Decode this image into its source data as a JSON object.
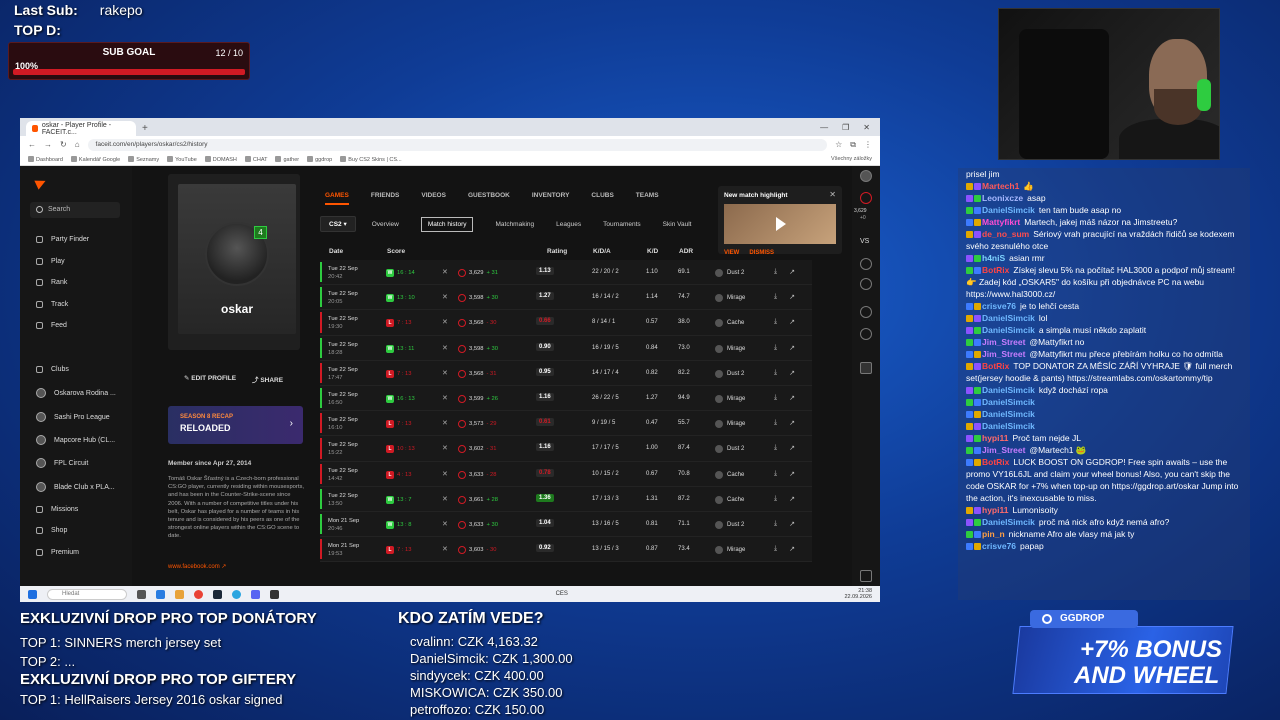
{
  "overlay": {
    "last_sub_label": "Last Sub:",
    "last_sub_value": "rakepo",
    "top_d_label": "TOP D:",
    "sub_goal_title": "SUB GOAL",
    "sub_goal_count": "12 / 10",
    "sub_goal_percent": "100%",
    "sub_goal_progress": 1.0
  },
  "browser": {
    "tab_title": "oskar - Player Profile - FACEIT.c...",
    "url": "faceit.com/en/players/oskar/cs2/history",
    "bookmarks": [
      "Dashboard",
      "Kalendář Google",
      "Seznamy",
      "YouTube",
      "DOMASH",
      "CHAT",
      "gather",
      "ggdrop",
      "Buy CS2 Skins | CS..."
    ],
    "bookmarks_right": "Všechny záložky"
  },
  "sidebar": {
    "search_placeholder": "Search",
    "items": [
      {
        "label": "Party Finder",
        "icon": "users-icon"
      },
      {
        "label": "Play",
        "icon": "play-icon"
      },
      {
        "label": "Rank",
        "icon": "trophy-icon"
      },
      {
        "label": "Track",
        "icon": "target-icon"
      },
      {
        "label": "Feed",
        "icon": "feed-icon"
      },
      {
        "label": "Clubs",
        "icon": "clubs-icon"
      },
      {
        "label": "Oskarova Rodina ...",
        "icon": "club-avatar-icon"
      },
      {
        "label": "Sashi Pro League",
        "icon": "club-avatar-icon"
      },
      {
        "label": "Mapcore Hub (CL...",
        "icon": "club-avatar-icon"
      },
      {
        "label": "FPL Circuit",
        "icon": "club-avatar-icon"
      },
      {
        "label": "Blade Club x PLA...",
        "icon": "club-avatar-icon"
      },
      {
        "label": "Missions",
        "icon": "missions-icon"
      },
      {
        "label": "Shop",
        "icon": "shop-icon"
      },
      {
        "label": "Premium",
        "icon": "premium-icon"
      }
    ]
  },
  "profile": {
    "name": "oskar",
    "level": "4",
    "edit_label": "EDIT PROFILE",
    "share_label": "SHARE",
    "recap_kicker": "SEASON 8 RECAP",
    "recap_title": "RELOADED",
    "member_since": "Member since Apr 27, 2014",
    "bio": "Tomáš Oskar Šťastný is a Czech-born professional CS:GO player, currently residing within mousesports, and has been in the Counter-Strike-scene since 2006. With a number of competitive titles under his belt, Oskar has played for a number of teams in his tenure and is considered by his peers as one of the strongest online players within the CS:GO scene to date.",
    "link": "www.facebook.com"
  },
  "topnav": [
    "GAMES",
    "FRIENDS",
    "VIDEOS",
    "GUESTBOOK",
    "INVENTORY",
    "CLUBS",
    "TEAMS"
  ],
  "subnav": {
    "game": "CS2",
    "items": [
      "Overview",
      "Match history",
      "Matchmaking",
      "Leagues",
      "Tournaments",
      "Skin Vault"
    ],
    "selected": "Match history"
  },
  "table": {
    "headers": {
      "date": "Date",
      "score": "Score",
      "rating": "Rating",
      "kda": "K/D/A",
      "kd": "K/D",
      "adr": "ADR",
      "map": "Map"
    },
    "rows": [
      {
        "day": "Tue 22 Sep",
        "time": "20:42",
        "win": true,
        "score": "16 : 14",
        "elo": "3,629",
        "delta": "+ 31",
        "rating": "1.13",
        "kda": "22 / 20 / 2",
        "kd": "1.10",
        "adr": "69.1",
        "map": "Dust 2"
      },
      {
        "day": "Tue 22 Sep",
        "time": "20:05",
        "win": true,
        "score": "13 : 10",
        "elo": "3,598",
        "delta": "+ 30",
        "rating": "1.27",
        "kda": "16 / 14 / 2",
        "kd": "1.14",
        "adr": "74.7",
        "map": "Mirage"
      },
      {
        "day": "Tue 22 Sep",
        "time": "19:30",
        "win": false,
        "score": "7 : 13",
        "elo": "3,568",
        "delta": "- 30",
        "rating": "0.66",
        "kda": "8 / 14 / 1",
        "kd": "0.57",
        "adr": "38.0",
        "map": "Cache"
      },
      {
        "day": "Tue 22 Sep",
        "time": "18:28",
        "win": true,
        "score": "13 : 11",
        "elo": "3,598",
        "delta": "+ 30",
        "rating": "0.90",
        "kda": "16 / 19 / 5",
        "kd": "0.84",
        "adr": "73.0",
        "map": "Mirage"
      },
      {
        "day": "Tue 22 Sep",
        "time": "17:47",
        "win": false,
        "score": "7 : 13",
        "elo": "3,568",
        "delta": "- 31",
        "rating": "0.95",
        "kda": "14 / 17 / 4",
        "kd": "0.82",
        "adr": "82.2",
        "map": "Dust 2"
      },
      {
        "day": "Tue 22 Sep",
        "time": "16:50",
        "win": true,
        "score": "16 : 13",
        "elo": "3,599",
        "delta": "+ 26",
        "rating": "1.16",
        "kda": "26 / 22 / 5",
        "kd": "1.27",
        "adr": "94.9",
        "map": "Mirage"
      },
      {
        "day": "Tue 22 Sep",
        "time": "16:10",
        "win": false,
        "score": "7 : 13",
        "elo": "3,573",
        "delta": "- 29",
        "rating": "0.61",
        "kda": "9 / 19 / 5",
        "kd": "0.47",
        "adr": "55.7",
        "map": "Mirage"
      },
      {
        "day": "Tue 22 Sep",
        "time": "15:22",
        "win": false,
        "score": "10 : 13",
        "elo": "3,602",
        "delta": "- 31",
        "rating": "1.16",
        "kda": "17 / 17 / 5",
        "kd": "1.00",
        "adr": "87.4",
        "map": "Dust 2"
      },
      {
        "day": "Tue 22 Sep",
        "time": "14:42",
        "win": false,
        "score": "4 : 13",
        "elo": "3,633",
        "delta": "- 28",
        "rating": "0.78",
        "kda": "10 / 15 / 2",
        "kd": "0.67",
        "adr": "70.8",
        "map": "Cache"
      },
      {
        "day": "Tue 22 Sep",
        "time": "13:50",
        "win": true,
        "score": "13 : 7",
        "elo": "3,661",
        "delta": "+ 28",
        "rating": "1.36",
        "kda": "17 / 13 / 3",
        "kd": "1.31",
        "adr": "87.2",
        "map": "Cache"
      },
      {
        "day": "Mon 21 Sep",
        "time": "20:46",
        "win": true,
        "score": "13 : 8",
        "elo": "3,633",
        "delta": "+ 30",
        "rating": "1.04",
        "kda": "13 / 16 / 5",
        "kd": "0.81",
        "adr": "71.1",
        "map": "Dust 2"
      },
      {
        "day": "Mon 21 Sep",
        "time": "19:53",
        "win": false,
        "score": "7 : 13",
        "elo": "3,603",
        "delta": "- 30",
        "rating": "0.92",
        "kda": "13 / 15 / 3",
        "kd": "0.87",
        "adr": "73.4",
        "map": "Mirage"
      }
    ]
  },
  "highlight": {
    "title": "New match highlight",
    "view": "VIEW",
    "dismiss": "DISMISS"
  },
  "rightrail": {
    "elo": "3,629",
    "elo_sub": "+0"
  },
  "taskbar": {
    "search": "Hledat",
    "time": "21:38",
    "date": "22.09.2026",
    "lang": "CES"
  },
  "chat": [
    {
      "user": "",
      "text": "prisel jim",
      "color": "#ffffff"
    },
    {
      "user": "Martech1",
      "text": "👍",
      "color": "#ff5a5a"
    },
    {
      "user": "Leonixcze",
      "text": "asap",
      "color": "#a7b8ff"
    },
    {
      "user": "DanielSimcik",
      "text": "ten tam bude asap no",
      "color": "#6fb8ff"
    },
    {
      "user": "Mattyfikrt",
      "text": "Martech, jakej máš názor na Jimstreetu?",
      "color": "#ff4dd2"
    },
    {
      "user": "de_no_sum",
      "text": "Sériový vrah pracující na vraždách řidičů se kodexem svého zesnulého otce",
      "color": "#ff4d4d"
    },
    {
      "user": "h4niS",
      "text": "asian rmr",
      "color": "#7fd4ff"
    },
    {
      "user": "BotRix",
      "text": "Získej slevu 5% na počítač HAL3000 a podpoř můj stream! 👉 Zadej kód „OSKAR5\" do košíku při objednávce PC na webu https://www.hal3000.cz/",
      "color": "#ff4444"
    },
    {
      "user": "crisve76",
      "text": "je to lehčí cesta",
      "color": "#6fb8ff"
    },
    {
      "user": "DanielSimcik",
      "text": "lol",
      "color": "#6fb8ff"
    },
    {
      "user": "DanielSimcik",
      "text": "a simpla musí někdo zaplatit",
      "color": "#6fb8ff"
    },
    {
      "user": "Jim_Street",
      "text": "@Mattyfikrt no",
      "color": "#c77dff"
    },
    {
      "user": "Jim_Street",
      "text": "@Mattyfikrt mu přece přebírám holku co ho odmítla",
      "color": "#c77dff"
    },
    {
      "user": "BotRix",
      "text": "TOP DONATOR ZA MĚSÍC ZÁŘÍ VYHRAJE 🛡 full merch set(jersey hoodie & pants) https://streamlabs.com/oskartommy/tip",
      "color": "#ff4444"
    },
    {
      "user": "DanielSimcik",
      "text": "když dochází ropa",
      "color": "#6fb8ff"
    },
    {
      "user": "DanielSimcik",
      "text": "",
      "color": "#6fb8ff"
    },
    {
      "user": "DanielSimcik",
      "text": "",
      "color": "#6fb8ff"
    },
    {
      "user": "DanielSimcik",
      "text": "",
      "color": "#6fb8ff"
    },
    {
      "user": "hypi11",
      "text": "Proč tam nejde JL",
      "color": "#ff6b6b"
    },
    {
      "user": "Jim_Street",
      "text": "@Martech1 🐸",
      "color": "#c77dff"
    },
    {
      "user": "BotRix",
      "text": "LUCK BOOST ON GGDROP! Free spin awaits – use the promo VY16L6JL and claim your wheel bonus! Also, you can't skip the code OSKAR for +7% when top-up on https://ggdrop.art/oskar Jump into the action, it's inexcusable to miss.",
      "color": "#ff4444"
    },
    {
      "user": "hypi11",
      "text": "Lumonisoity",
      "color": "#ff6b6b"
    },
    {
      "user": "DanielSimcik",
      "text": "proč má nick afro když nemá afro?",
      "color": "#6fb8ff"
    },
    {
      "user": "pin_n",
      "text": "nickname Afro ale vlasy má jak ty",
      "color": "#ff9f43"
    },
    {
      "user": "crisve76",
      "text": "papap",
      "color": "#6fb8ff"
    }
  ],
  "bottom": {
    "donor_title": "EXKLUZIVNÍ DROP PRO TOP DONÁTORY",
    "donor_top1": "TOP 1: SINNERS merch jersey set",
    "donor_top2": "TOP 2:  ...",
    "gifter_title": "EXKLUZIVNÍ DROP PRO TOP GIFTERY",
    "gifter_top1": "TOP 1: HellRaisers Jersey 2016 oskar signed",
    "leader_title": "KDO ZATÍM VEDE?",
    "leaders": [
      "cvalinn: CZK 4,163.32",
      "DanielSimcik: CZK 1,300.00",
      "sindyycek: CZK 400.00",
      "MISKOWICA: CZK 350.00",
      "petroffozo: CZK 150.00"
    ]
  },
  "ggdrop": {
    "brand": "GGDROP",
    "line1": "+7% BONUS",
    "line2": "AND WHEEL"
  }
}
